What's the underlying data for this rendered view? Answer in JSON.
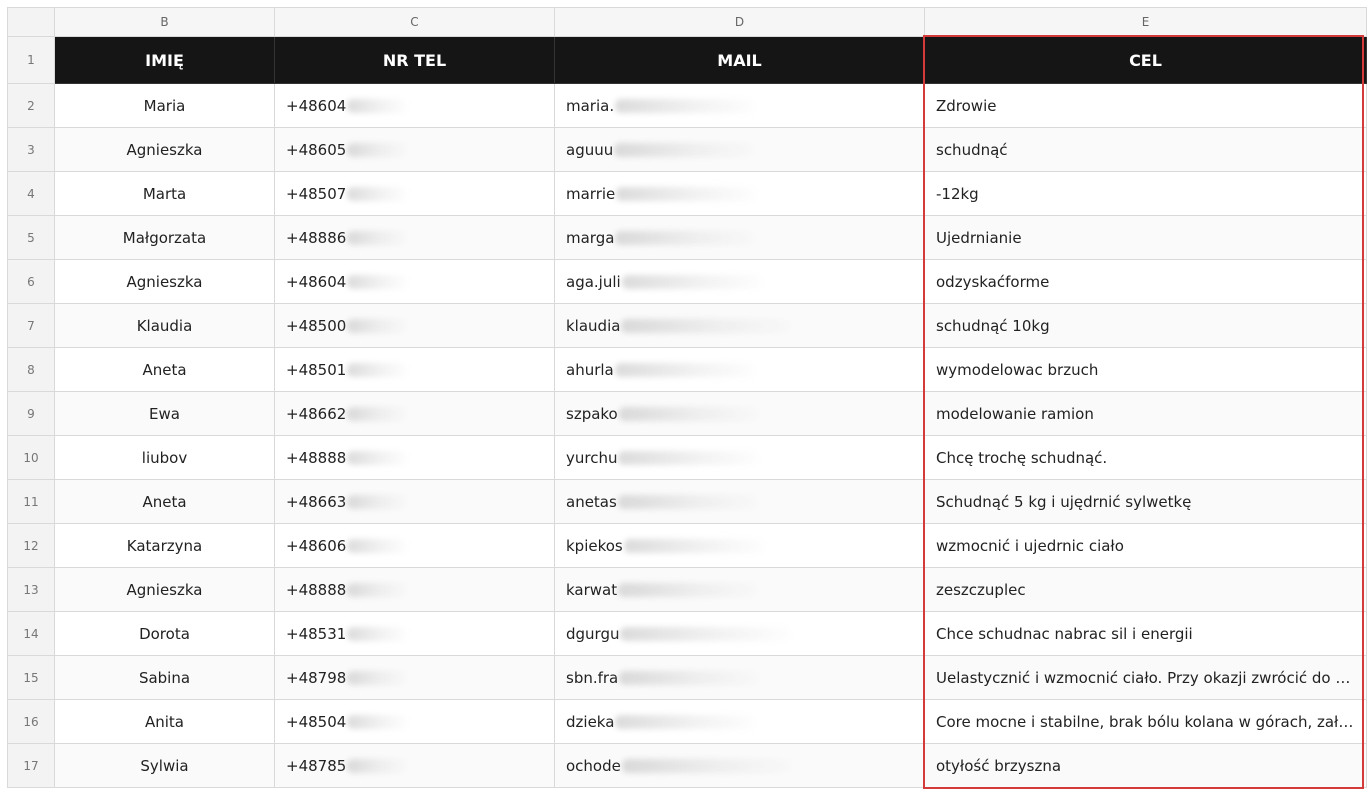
{
  "column_letters": [
    "B",
    "C",
    "D",
    "E"
  ],
  "header_row_number": "1",
  "headers": {
    "name": "IMIĘ",
    "phone": "NR TEL",
    "mail": "MAIL",
    "goal": "CEL"
  },
  "selection_color": "#d33a3a",
  "rows": [
    {
      "num": "2",
      "name": "Maria",
      "phone": "+48604",
      "mail": "maria.",
      "goal": "Zdrowie"
    },
    {
      "num": "3",
      "name": "Agnieszka",
      "phone": "+48605",
      "mail": "aguuu",
      "goal": "schudnąć"
    },
    {
      "num": "4",
      "name": "Marta",
      "phone": "+48507",
      "mail": "marrie",
      "goal": "-12kg"
    },
    {
      "num": "5",
      "name": "Małgorzata",
      "phone": "+48886",
      "mail": "marga",
      "goal": "Ujedrnianie"
    },
    {
      "num": "6",
      "name": "Agnieszka",
      "phone": "+48604",
      "mail": "aga.juli",
      "goal": "odzyskaćforme"
    },
    {
      "num": "7",
      "name": "Klaudia",
      "phone": "+48500",
      "mail": "klaudia",
      "goal": "schudnąć 10kg"
    },
    {
      "num": "8",
      "name": "Aneta",
      "phone": "+48501",
      "mail": "ahurla",
      "goal": "wymodelowac brzuch"
    },
    {
      "num": "9",
      "name": "Ewa",
      "phone": "+48662",
      "mail": "szpako",
      "goal": "modelowanie ramion"
    },
    {
      "num": "10",
      "name": "liubov",
      "phone": "+48888",
      "mail": "yurchu",
      "goal": "Chcę trochę schudnąć."
    },
    {
      "num": "11",
      "name": "Aneta",
      "phone": "+48663",
      "mail": "anetas",
      "goal": "Schudnąć 5 kg i ujędrnić sylwetkę"
    },
    {
      "num": "12",
      "name": "Katarzyna",
      "phone": "+48606",
      "mail": "kpiekos",
      "goal": "wzmocnić i ujedrnic ciało"
    },
    {
      "num": "13",
      "name": "Agnieszka",
      "phone": "+48888",
      "mail": "karwat",
      "goal": "zeszczuplec"
    },
    {
      "num": "14",
      "name": "Dorota",
      "phone": "+48531",
      "mail": "dgurgu",
      "goal": "Chce schudnac nabrac sil i energii"
    },
    {
      "num": "15",
      "name": "Sabina",
      "phone": "+48798",
      "mail": "sbn.fra",
      "goal": "Uelastycznić i wzmocnić ciało. Przy okazji zwrócić do W..."
    },
    {
      "num": "16",
      "name": "Anita",
      "phone": "+48504",
      "mail": "dzieka",
      "goal": "Core mocne i stabilne, brak bólu kolana w górach, zało..."
    },
    {
      "num": "17",
      "name": "Sylwia",
      "phone": "+48785",
      "mail": "ochode",
      "goal": "otyłość brzyszna"
    }
  ]
}
